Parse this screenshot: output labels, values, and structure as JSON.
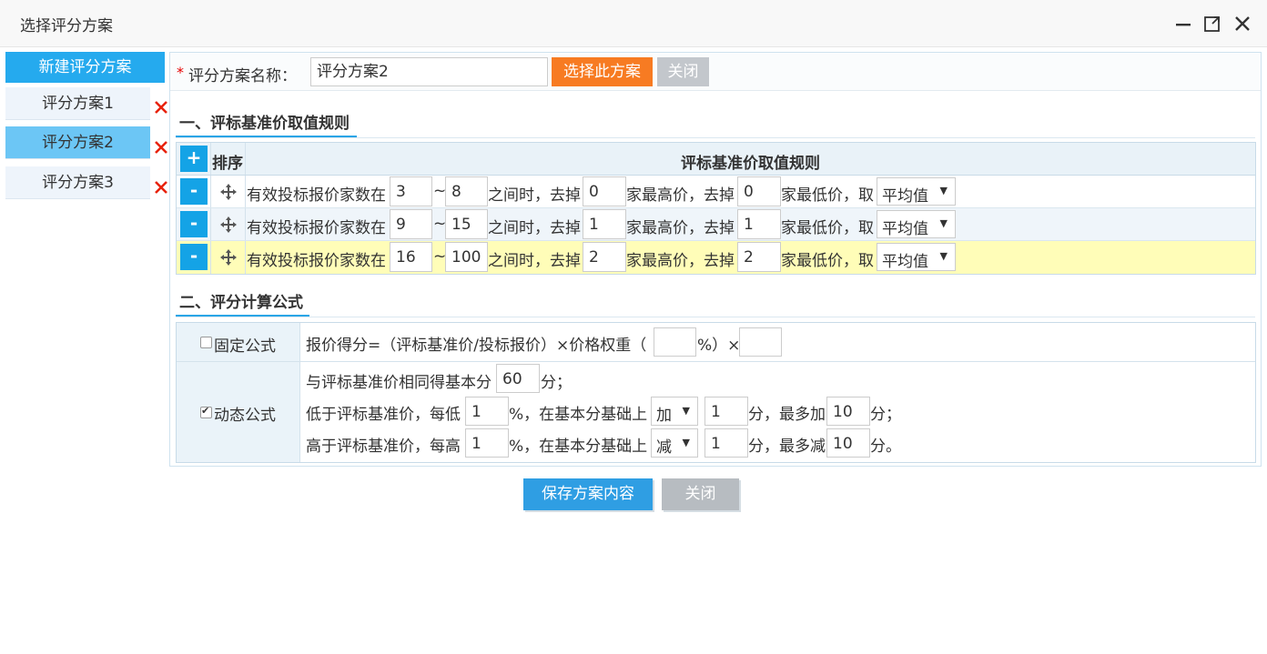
{
  "window": {
    "title": "选择评分方案"
  },
  "sidebar": {
    "new_label": "新建评分方案",
    "items": [
      {
        "label": "评分方案1",
        "active": false
      },
      {
        "label": "评分方案2",
        "active": true
      },
      {
        "label": "评分方案3",
        "active": false
      }
    ]
  },
  "top": {
    "required_mark": "*",
    "name_label": "评分方案名称：",
    "name_value": "评分方案2",
    "choose_label": "选择此方案",
    "close_label": "关闭"
  },
  "section1": {
    "title": "一、评标基准价取值规则",
    "add_symbol": "+",
    "col_sort": "排序",
    "col_rule": "评标基准价取值规则",
    "remove_symbol": "-",
    "text_a": "有效投标报价家数在",
    "tilde": "~",
    "text_b": "之间时，去掉",
    "text_c": "家最高价，去掉",
    "text_d": "家最低价，取",
    "rows": [
      {
        "min": "3",
        "max": "8",
        "drop_high": "0",
        "drop_low": "0",
        "method": "平均值"
      },
      {
        "min": "9",
        "max": "15",
        "drop_high": "1",
        "drop_low": "1",
        "method": "平均值"
      },
      {
        "min": "16",
        "max": "100",
        "drop_high": "2",
        "drop_low": "2",
        "method": "平均值"
      }
    ]
  },
  "section2": {
    "title": "二、评分计算公式",
    "fixed": {
      "label": "固定公式",
      "checked": false,
      "text_a": "报价得分=（评标基准价/投标报价）×价格权重（",
      "weight": "",
      "text_b": "%）×",
      "factor": ""
    },
    "dynamic": {
      "label": "动态公式",
      "checked": true,
      "line1_a": "与评标基准价相同得基本分",
      "base_score": "60",
      "line1_b": "分；",
      "line2_a": "低于评标基准价，每低",
      "low_pct": "1",
      "line2_b": "%，在基本分基础上",
      "low_op": "加",
      "low_step": "1",
      "line2_c": "分，最多加",
      "low_max": "10",
      "line2_d": "分；",
      "line3_a": "高于评标基准价，每高",
      "high_pct": "1",
      "line3_b": "%，在基本分基础上",
      "high_op": "减",
      "high_step": "1",
      "line3_c": "分，最多减",
      "high_max": "10",
      "line3_d": "分。"
    }
  },
  "footer": {
    "save_label": "保存方案内容",
    "close_label": "关闭"
  },
  "colors": {
    "primary": "#2f9ee3",
    "accent": "#f77b22",
    "highlight_row": "#fffdb8",
    "delete": "#e8220b"
  }
}
